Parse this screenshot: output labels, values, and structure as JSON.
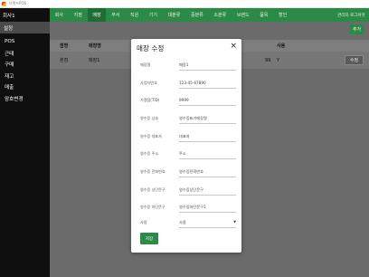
{
  "window": {
    "title": "브랜드POS"
  },
  "topbar": {
    "brand": "회사1",
    "menu": [
      "회사",
      "지점",
      "매장",
      "부서",
      "직원",
      "기기",
      "대분류",
      "중분류",
      "소분류",
      "브랜드",
      "품목",
      "할인"
    ],
    "active_index": 2,
    "user": "관리자 로그아웃"
  },
  "sidebar": {
    "heading": "설정",
    "items": [
      "POS",
      "근태",
      "구매",
      "재고",
      "매출",
      "암호변경"
    ]
  },
  "main": {
    "add_button": "추가",
    "table": {
      "headers": {
        "branch": "점명",
        "store": "매장명",
        "use": "사용"
      },
      "row": {
        "branch": "본점",
        "store": "매장1",
        "x": "99",
        "use": "Y",
        "edit": "수정"
      }
    }
  },
  "modal": {
    "title": "매장 수정",
    "close": "×",
    "fields": [
      {
        "label": "매장명",
        "value": "매장1"
      },
      {
        "label": "사업자번호",
        "value": "123-45-67890"
      },
      {
        "label": "가맹점(TID)",
        "value": "9999"
      },
      {
        "label": "영수증 상호",
        "value": "영수증표기매장명"
      },
      {
        "label": "영수증 대표자",
        "value": "대표자"
      },
      {
        "label": "영수증 주소",
        "value": "주소"
      },
      {
        "label": "영수증 전화번호",
        "value": "영수증전화번호"
      },
      {
        "label": "영수증 상단문구",
        "value": "영수증상단문구"
      },
      {
        "label": "영수증 하단문구",
        "value": "영수증하단문구1"
      }
    ],
    "use_field": {
      "label": "사용",
      "value": "사용"
    },
    "save_button": "저장"
  },
  "colors": {
    "green": "#2a8a46",
    "dark": "#0f0f0f",
    "overlay": "#6b6b6b"
  }
}
